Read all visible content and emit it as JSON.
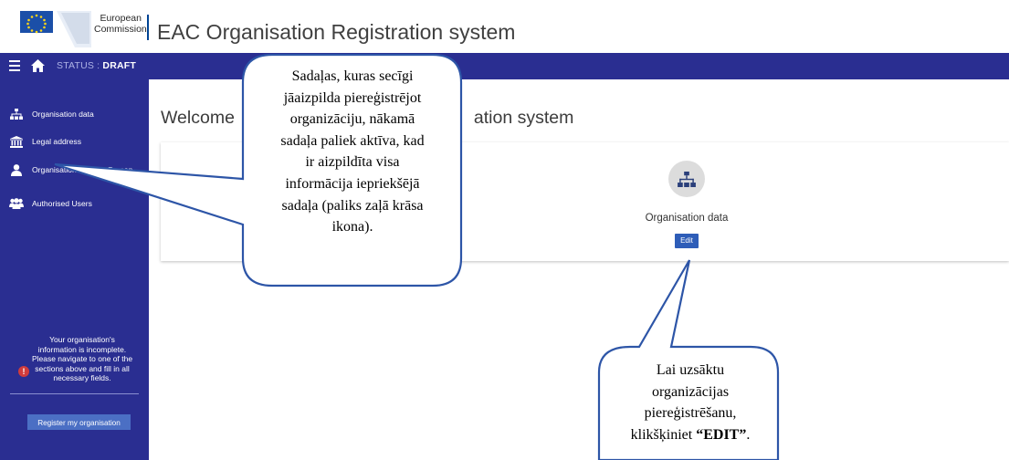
{
  "header": {
    "logo_line1": "European",
    "logo_line2": "Commission",
    "app_title": "EAC Organisation Registration system",
    "brand_color": "#004494"
  },
  "navbar": {
    "status_label": "STATUS :",
    "status_value": "DRAFT",
    "color": "#2a2e91"
  },
  "sidebar": {
    "items": [
      {
        "label": "Organisation data",
        "icon": "sitemap-icon"
      },
      {
        "label": "Legal address",
        "icon": "bank-icon"
      },
      {
        "label": "Organisation Contact Person",
        "icon": "user-icon"
      },
      {
        "label": "Authorised Users",
        "icon": "users-icon"
      }
    ],
    "warning_message": "Your organisation's information is incomplete. Please navigate to one of the sections above and fill in all necessary fields.",
    "register_button": "Register my organisation"
  },
  "main": {
    "welcome_start": "Welcome",
    "welcome_end": "ation system",
    "card": {
      "label": "Organisation data",
      "edit_button": "Edit",
      "icon": "sitemap-icon"
    }
  },
  "callouts": {
    "top": {
      "lines": [
        "Sadaļas, kuras secīgi",
        "jāaizpilda piereģistrējot",
        "organizāciju, nākamā",
        "sadaļa paliek aktīva, kad",
        "ir aizpildīta visa",
        "informācija iepriekšējā",
        "sadaļa (paliks zaļā krāsa",
        "ikona)."
      ]
    },
    "bottom": {
      "lines": [
        "Lai uzsāktu",
        "organizācijas",
        "piereģistrēšanu,"
      ],
      "last_prefix": "klikšķiniet ",
      "last_bold": "“EDIT”",
      "last_suffix": "."
    }
  }
}
